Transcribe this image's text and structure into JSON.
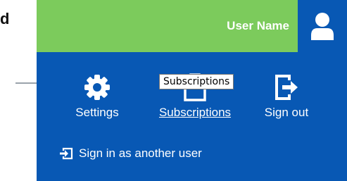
{
  "background": {
    "partial_char": "d"
  },
  "header": {
    "username": "User Name",
    "avatar_icon": "user-icon",
    "bar_color": "#7ccb5c",
    "accent_color": "#0858b4"
  },
  "menu": {
    "settings": {
      "label": "Settings",
      "icon": "gear-icon"
    },
    "subscriptions": {
      "label": "Subscriptions",
      "icon": "clipboard-icon"
    },
    "sign_out": {
      "label": "Sign out",
      "icon": "sign-out-icon"
    },
    "sign_in_other": {
      "label": "Sign in as another user",
      "icon": "sign-in-icon"
    }
  },
  "tooltip": {
    "text": "Subscriptions"
  }
}
